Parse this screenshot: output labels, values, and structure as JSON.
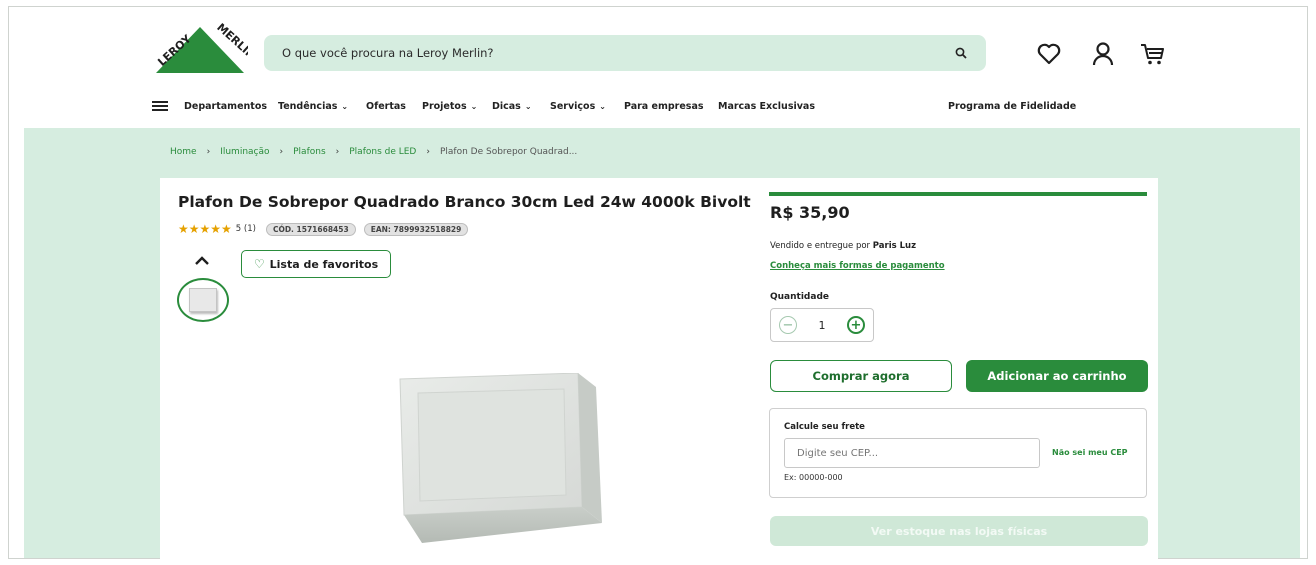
{
  "brand": {
    "name_line1": "LEROY",
    "name_line2": "MERLIN",
    "color": "#2a8c3c"
  },
  "search": {
    "placeholder": "O que você procura na Leroy Merlin?",
    "icon": "search-icon"
  },
  "header_icons": [
    "heart-icon",
    "user-icon",
    "cart-icon"
  ],
  "nav": {
    "departments": "Departamentos",
    "items": [
      {
        "label": "Tendências",
        "dropdown": true
      },
      {
        "label": "Ofertas",
        "dropdown": false
      },
      {
        "label": "Projetos",
        "dropdown": true
      },
      {
        "label": "Dicas",
        "dropdown": true
      },
      {
        "label": "Serviços",
        "dropdown": true
      },
      {
        "label": "Para empresas",
        "dropdown": false
      },
      {
        "label": "Marcas Exclusivas",
        "dropdown": false
      }
    ],
    "loyalty": "Programa de Fidelidade"
  },
  "breadcrumb": [
    "Home",
    "Iluminação",
    "Plafons",
    "Plafons de LED",
    "Plafon De Sobrepor Quadrad..."
  ],
  "product": {
    "title": "Plafon De Sobrepor Quadrado Branco 30cm Led 24w 4000k Bivolt",
    "stars": "★★★★★",
    "rating_value": 5,
    "rating": "5 (1)",
    "cod": "CÓD. 1571668453",
    "ean": "EAN: 7899932518829",
    "favorites_label": "Lista de favoritos",
    "price": "R$ 35,90",
    "sold_by_prefix": "Vendido e entregue por ",
    "seller": "Paris Luz",
    "payment_link": "Conheça mais formas de pagamento",
    "quantity_label": "Quantidade",
    "quantity": "1",
    "buy_now": "Comprar agora",
    "add_to_cart": "Adicionar ao carrinho"
  },
  "freight": {
    "title": "Calcule seu frete",
    "placeholder": "Digite seu CEP...",
    "dont_know": "Não sei meu CEP",
    "example": "Ex: 00000-000"
  },
  "stock_button": "Ver estoque nas lojas físicas"
}
